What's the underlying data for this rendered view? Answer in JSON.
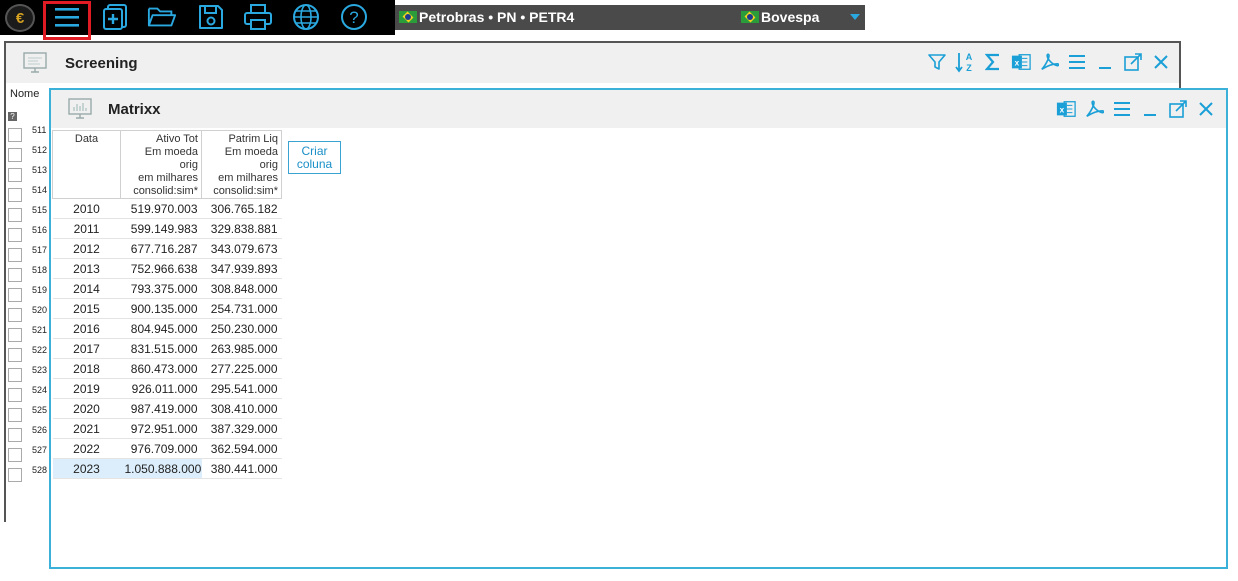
{
  "toolbar": {
    "icons": [
      "menu-icon",
      "new-document-icon",
      "open-folder-icon",
      "save-icon",
      "print-icon",
      "globe-icon",
      "help-icon"
    ]
  },
  "ticker": {
    "stock": "Petrobras • PN • PETR4",
    "exchange": "Bovespa"
  },
  "screening": {
    "title": "Screening",
    "column_header": "Nome",
    "help_mark": "?",
    "rows": [
      "511",
      "512",
      "513",
      "514",
      "515",
      "516",
      "517",
      "518",
      "519",
      "520",
      "521",
      "522",
      "523",
      "524",
      "525",
      "526",
      "527",
      "528"
    ]
  },
  "matrixx": {
    "title": "Matrixx",
    "columns": [
      {
        "lines": [
          "Data"
        ]
      },
      {
        "lines": [
          "Ativo Tot",
          "Em moeda orig",
          "em milhares",
          "consolid:sim*"
        ]
      },
      {
        "lines": [
          "Patrim Liq",
          "Em moeda orig",
          "em milhares",
          "consolid:sim*"
        ]
      }
    ],
    "rows": [
      [
        "2010",
        "519.970.003",
        "306.765.182"
      ],
      [
        "2011",
        "599.149.983",
        "329.838.881"
      ],
      [
        "2012",
        "677.716.287",
        "343.079.673"
      ],
      [
        "2013",
        "752.966.638",
        "347.939.893"
      ],
      [
        "2014",
        "793.375.000",
        "308.848.000"
      ],
      [
        "2015",
        "900.135.000",
        "254.731.000"
      ],
      [
        "2016",
        "804.945.000",
        "250.230.000"
      ],
      [
        "2017",
        "831.515.000",
        "263.985.000"
      ],
      [
        "2018",
        "860.473.000",
        "277.225.000"
      ],
      [
        "2019",
        "926.011.000",
        "295.541.000"
      ],
      [
        "2020",
        "987.419.000",
        "308.410.000"
      ],
      [
        "2021",
        "972.951.000",
        "387.329.000"
      ],
      [
        "2022",
        "976.709.000",
        "362.594.000"
      ],
      [
        "2023",
        "1.050.888.000",
        "380.441.000"
      ]
    ],
    "create_column_label": "Criar coluna"
  }
}
